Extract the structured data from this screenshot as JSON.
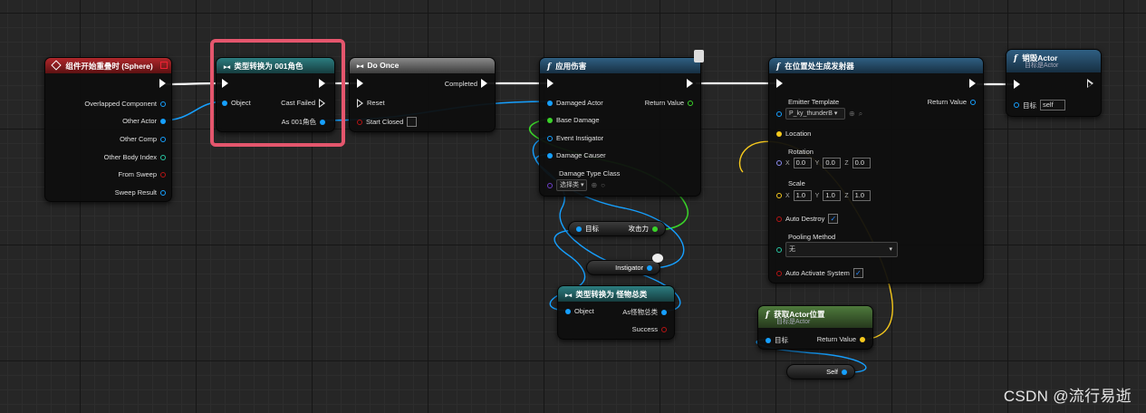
{
  "nodes": {
    "overlap_event": {
      "title": "组件开始重叠时 (Sphere)",
      "pins": [
        "Overlapped Component",
        "Other Actor",
        "Other Comp",
        "Other Body Index",
        "From Sweep",
        "Sweep Result"
      ]
    },
    "cast_role": {
      "title": "类型转换为 001角色",
      "object": "Object",
      "cast_failed": "Cast Failed",
      "as_out": "As 001角色"
    },
    "do_once": {
      "title": "Do Once",
      "completed": "Completed",
      "reset": "Reset",
      "start_closed": "Start Closed"
    },
    "apply_damage": {
      "title": "应用伤害",
      "damaged_actor": "Damaged Actor",
      "return_value": "Return Value",
      "base_damage": "Base Damage",
      "event_instigator": "Event Instigator",
      "damage_causer": "Damage Causer",
      "damage_type_class": "Damage Type Class",
      "damage_type_value": "选择类"
    },
    "spawn_emitter": {
      "title": "在位置处生成发射器",
      "emitter_template": "Emitter Template",
      "emitter_value": "P_ky_thunderB",
      "return_value": "Return Value",
      "location": "Location",
      "rotation": "Rotation",
      "rotation_values": [
        "0.0",
        "0.0",
        "0.0"
      ],
      "scale": "Scale",
      "scale_values": [
        "1.0",
        "1.0",
        "1.0"
      ],
      "axis_labels": [
        "X",
        "Y",
        "Z"
      ],
      "auto_destroy": "Auto Destroy",
      "pooling_method": "Pooling Method",
      "pooling_value": "无",
      "auto_activate": "Auto Activate System"
    },
    "destroy_actor": {
      "title": "销毁Actor",
      "subtitle": "目标是Actor",
      "target": "目标",
      "target_value": "self"
    },
    "get_attack": {
      "target": "目标",
      "output": "攻击力"
    },
    "instigator_node": {
      "label": "Instigator"
    },
    "cast_monster": {
      "title": "类型转换为 怪物总类",
      "object": "Object",
      "as_out": "As怪物总类",
      "success": "Success"
    },
    "get_actor_location": {
      "title": "获取Actor位置",
      "subtitle": "目标是Actor",
      "target": "目标",
      "return_value": "Return Value"
    },
    "self_node": {
      "label": "Self"
    }
  },
  "watermark": "CSDN @流行易逝",
  "colors": {
    "object_pin": "#16a0ff",
    "float_pin": "#3ad329",
    "bool_pin": "#b61414",
    "vector_pin": "#f6c91d",
    "highlight": "#e4566d"
  }
}
